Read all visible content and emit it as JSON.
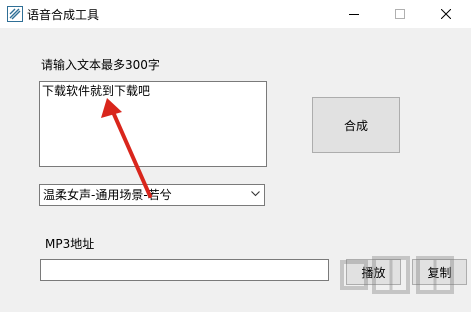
{
  "window": {
    "title": "语音合成工具"
  },
  "form": {
    "text_label": "请输入文本最多300字",
    "text_value": "下载软件就到下载吧",
    "synthesize_label": "合成",
    "voice_selected": "温柔女声-通用场景-若兮",
    "mp3_label": "MP3地址",
    "mp3_value": "",
    "play_label": "播放",
    "copy_label": "复制"
  },
  "colors": {
    "annotation_arrow": "#d9261c",
    "icon_accent": "#2f6f96"
  },
  "icons": [
    "app-icon",
    "minimize-icon",
    "maximize-icon",
    "close-icon",
    "chevron-down-icon",
    "annotation-arrow",
    "watermark-logo"
  ]
}
